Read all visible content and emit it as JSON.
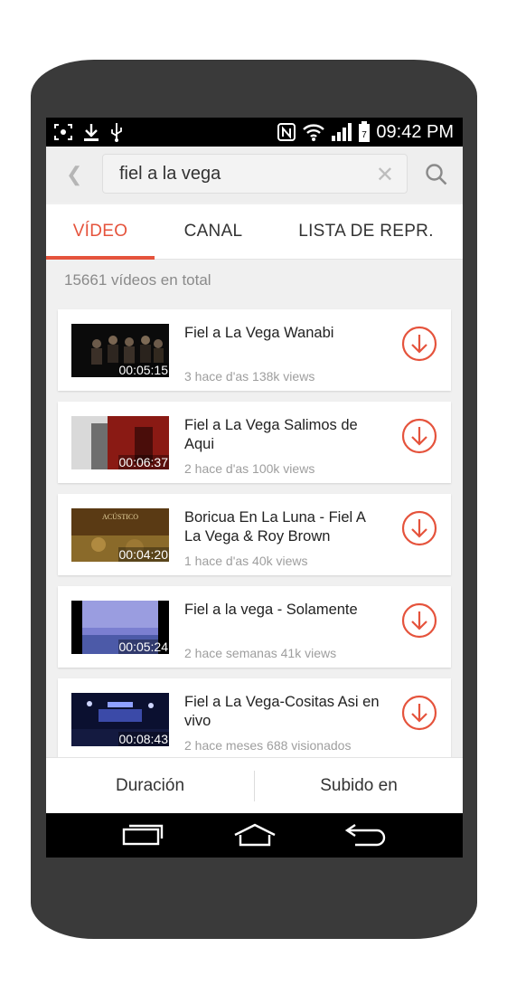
{
  "status": {
    "time": "09:42 PM",
    "battery": "88"
  },
  "search": {
    "query": "fiel a la vega",
    "placeholder": ""
  },
  "tabs": [
    {
      "label": "VÍDEO",
      "active": true
    },
    {
      "label": "CANAL"
    },
    {
      "label": "LISTA DE REPR."
    }
  ],
  "total_text": "15661 vídeos en total",
  "videos": [
    {
      "title": "Fiel a La Vega Wanabi",
      "duration": "00:05:15",
      "meta": "3 hace d'as 138k views"
    },
    {
      "title": "Fiel a La Vega Salimos de Aqui",
      "duration": "00:06:37",
      "meta": "2 hace d'as 100k views"
    },
    {
      "title": "Boricua En La Luna - Fiel A La Vega & Roy Brown",
      "duration": "00:04:20",
      "meta": "1 hace d'as 40k views"
    },
    {
      "title": "Fiel a la vega - Solamente",
      "duration": "00:05:24",
      "meta": "2 hace semanas 41k views"
    },
    {
      "title": "Fiel a La Vega-Cositas Asi en vivo",
      "duration": "00:08:43",
      "meta": "2 hace meses 688 visionados"
    }
  ],
  "bottom": {
    "duration_label": "Duración",
    "uploaded_label": "Subido en"
  },
  "colors": {
    "accent": "#e5533c",
    "phone_body": "#3a3a3a",
    "status_bar": "#000000"
  },
  "icons": [
    "screenshot-icon",
    "download-notification-icon",
    "usb-icon",
    "nfc-icon",
    "wifi-icon",
    "signal-icon",
    "battery-icon",
    "back-icon",
    "clear-icon",
    "search-icon",
    "download-icon",
    "recent-apps-icon",
    "home-icon",
    "back-nav-icon"
  ]
}
